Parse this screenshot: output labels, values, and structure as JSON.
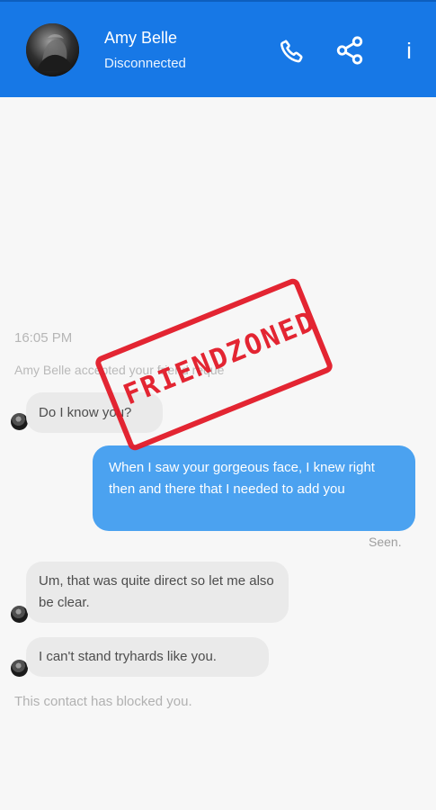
{
  "header": {
    "contact_name": "Amy Belle",
    "contact_status": "Disconnected",
    "icons": {
      "call": "phone-icon",
      "share": "share-icon",
      "info": "info-icon"
    },
    "info_label": "i"
  },
  "chat": {
    "timestamp": "16:05 PM",
    "system_message": "Amy Belle accepted your friend reque",
    "messages": [
      {
        "direction": "received",
        "text": "Do I know you?"
      },
      {
        "direction": "sent",
        "text": "When I saw your gorgeous face, I knew right then and there that I needed to add you"
      },
      {
        "direction": "received",
        "text": "Um, that was quite direct so let me also be clear."
      },
      {
        "direction": "received",
        "text": "I can't stand tryhards like you."
      }
    ],
    "seen_label": "Seen.",
    "blocked_message": "This contact has blocked you."
  },
  "overlay": {
    "stamp_text": "FRIENDZONED",
    "stamp_color": "#e21a28"
  },
  "colors": {
    "header_blue": "#1778e6",
    "sent_bubble": "#4ba2f0",
    "received_bubble": "#eaeaea"
  }
}
